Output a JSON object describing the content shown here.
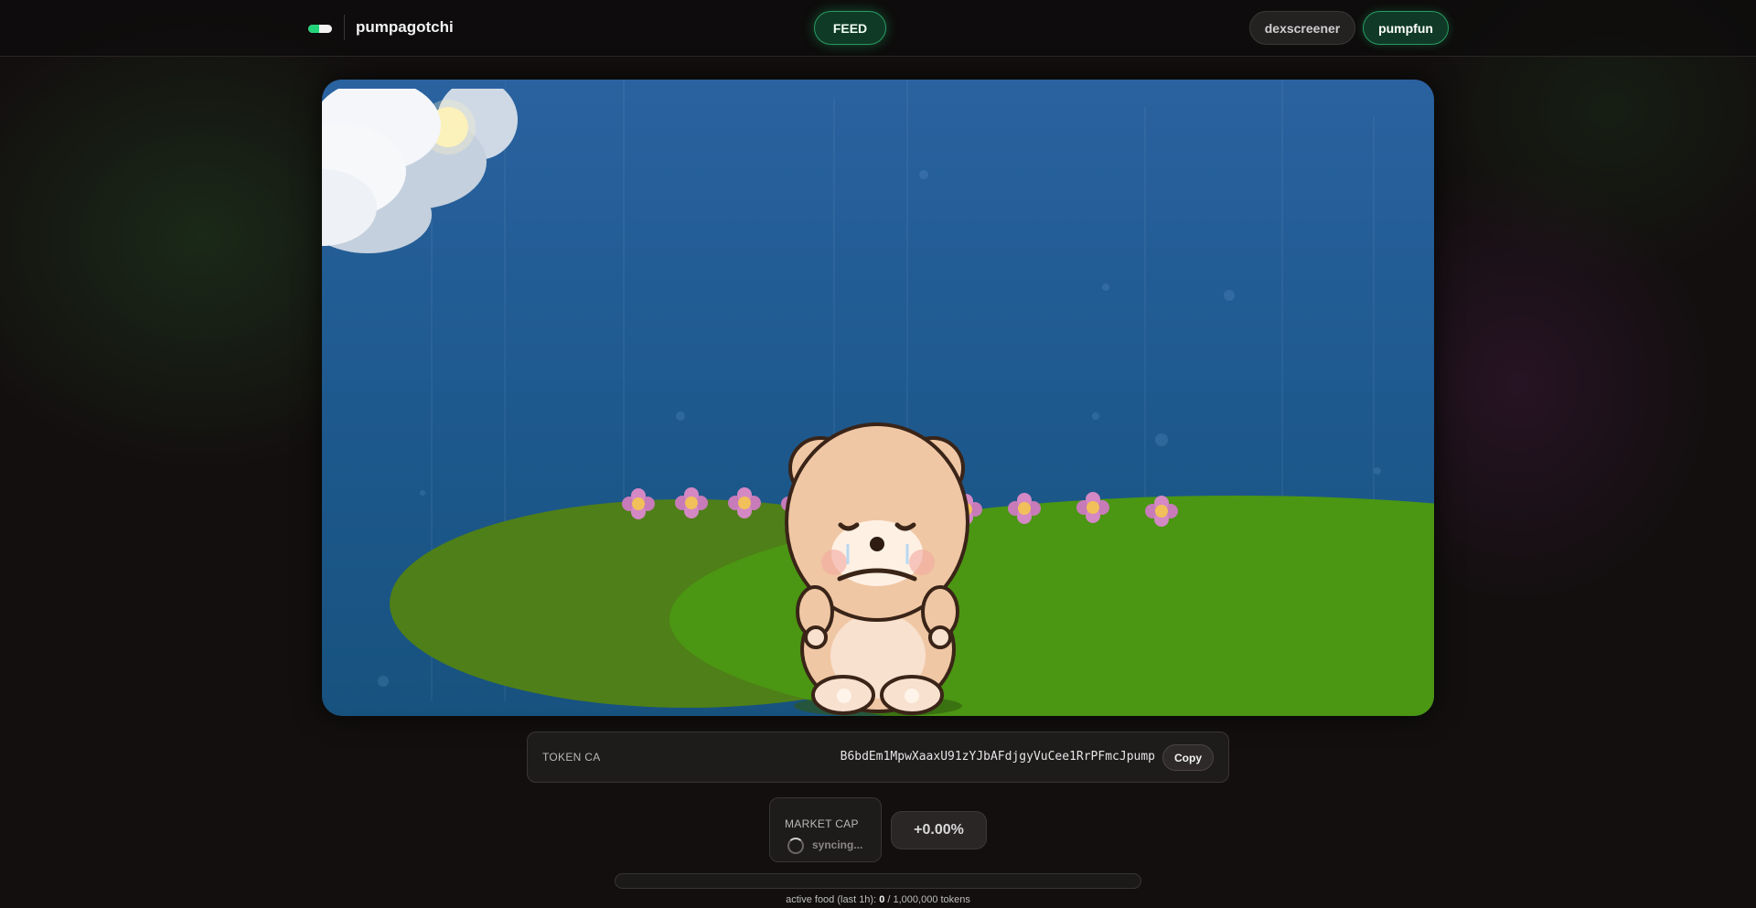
{
  "header": {
    "brand": "pumpagotchi",
    "logo_icon": "toggle-pill-icon",
    "feed_label": "FEED",
    "dexscreener_label": "dexscreener",
    "pumpfun_label": "pumpfun"
  },
  "scene": {
    "description_icon": "crying-bear-pet",
    "sky_color": "#2a62a0",
    "grass_color": "#4e9a12"
  },
  "token": {
    "label": "TOKEN CA",
    "address": "B6bdEm1MpwXaaxU91zYJbAFdjgyVuCee1RrPFmcJpump",
    "copy_label": "Copy"
  },
  "market": {
    "label": "MARKET CAP",
    "status": "syncing...",
    "change": "+0.00%"
  },
  "food": {
    "prefix": "active food (last 1h): ",
    "current": "0",
    "suffix": " / 1,000,000 tokens",
    "fill_fraction": 0
  },
  "colors": {
    "accent": "#22d37a",
    "background": "#130f0f"
  }
}
